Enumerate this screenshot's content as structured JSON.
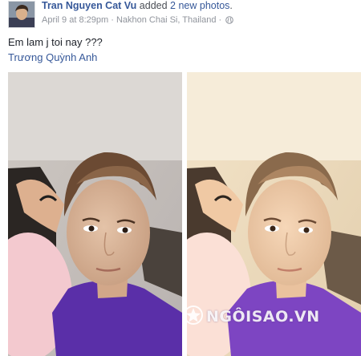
{
  "post": {
    "author": "Tran Nguyen Cat Vu",
    "action_prefix": "added",
    "action_link": "2 new photos",
    "action_suffix": ".",
    "date": "April 9 at 8:29pm",
    "separator": " · ",
    "location": "Nakhon Chai Si, Thailand",
    "location_separator": " · ",
    "privacy_icon": "globe-icon",
    "text": "Em lam j toi nay ???",
    "tagged_name": "Trương Quỳnh Anh",
    "photos": [
      {
        "name": "photo-1",
        "tone": "cool"
      },
      {
        "name": "photo-2",
        "tone": "warm"
      }
    ]
  },
  "watermark": {
    "text": "NGÔISAO.VN"
  },
  "colors": {
    "link": "#365899",
    "meta": "#90949c",
    "text": "#1d2129"
  }
}
